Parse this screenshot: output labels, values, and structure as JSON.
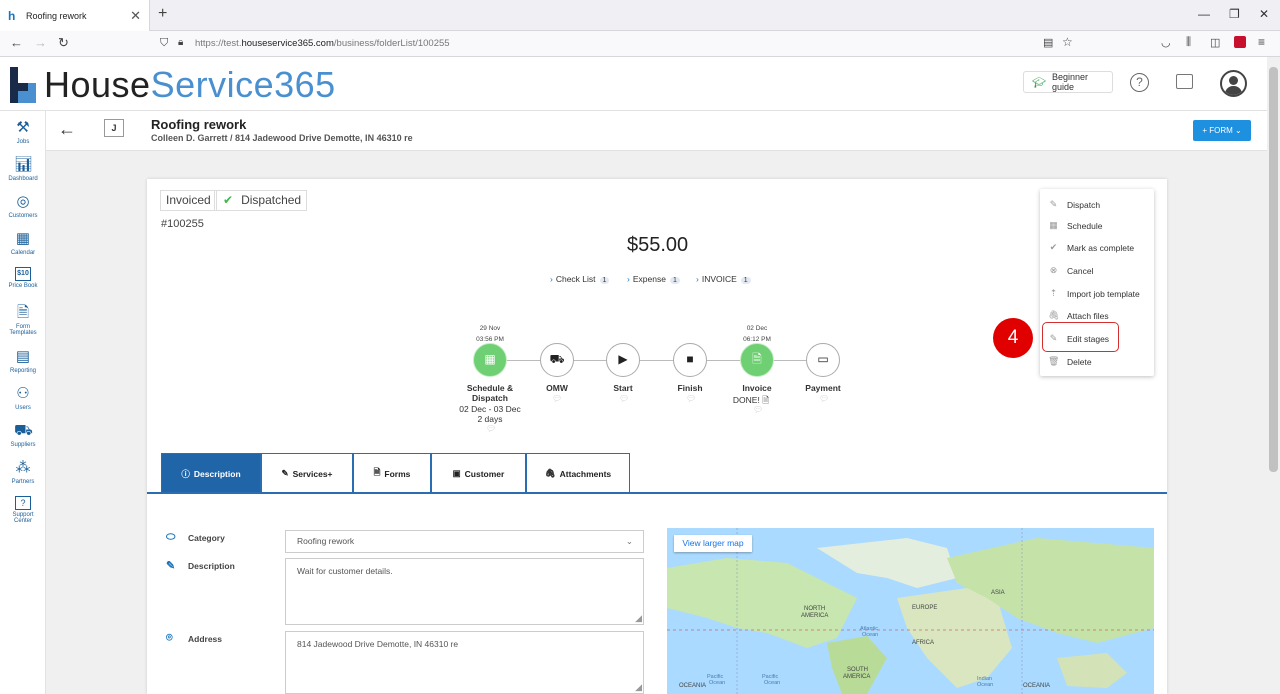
{
  "browser": {
    "tab_title": "Roofing rework",
    "url_prefix": "https://test.",
    "url_domain": "houseservice365.com",
    "url_path": "/business/folderList/100255"
  },
  "header": {
    "logo_part1": "House",
    "logo_part2": "Service365",
    "beginner_guide": "Beginner guide",
    "help_symbol": "?"
  },
  "sidebar": [
    {
      "label": "Jobs",
      "icon": "tools-icon"
    },
    {
      "label": "Dashboard",
      "icon": "dashboard-icon"
    },
    {
      "label": "Customers",
      "icon": "customers-icon"
    },
    {
      "label": "Calendar",
      "icon": "calendar-icon"
    },
    {
      "label": "Price Book",
      "icon": "price-book-icon",
      "glyph": "$10"
    },
    {
      "label": "Form",
      "label2": "Templates",
      "icon": "form-templates-icon"
    },
    {
      "label": "Reporting",
      "icon": "reporting-icon"
    },
    {
      "label": "Users",
      "icon": "users-icon"
    },
    {
      "label": "Suppliers",
      "icon": "truck-icon"
    },
    {
      "label": "Partners",
      "icon": "partners-icon"
    },
    {
      "label": "Support",
      "label2": "Center",
      "icon": "support-icon"
    }
  ],
  "job": {
    "badge": "J",
    "title": "Roofing rework",
    "subtitle": "Colleen D. Garrett / 814 Jadewood Drive Demotte, IN 46310 re",
    "form_button": "+ FORM ⌄",
    "status_invoiced": "Invoiced",
    "status_dispatched": "Dispatched",
    "number": "#100255",
    "price": "$55.00",
    "links": [
      {
        "label": "Check List",
        "count": "1"
      },
      {
        "label": "Expense",
        "count": "1"
      },
      {
        "label": "INVOICE",
        "count": "1"
      }
    ]
  },
  "stages": [
    {
      "label": "Schedule &",
      "label2": "Dispatch",
      "date": "29 Nov",
      "time": "03:56 PM",
      "extra1": "02 Dec - 03 Dec",
      "extra2": "2 days",
      "done": true
    },
    {
      "label": "OMW",
      "done": false
    },
    {
      "label": "Start",
      "done": false
    },
    {
      "label": "Finish",
      "done": false
    },
    {
      "label": "Invoice",
      "date": "02 Dec",
      "time": "06:12 PM",
      "extra1": "DONE!",
      "done": true
    },
    {
      "label": "Payment",
      "done": false
    }
  ],
  "menu": [
    {
      "label": "Dispatch",
      "icon": "pencil-icon"
    },
    {
      "label": "Schedule",
      "icon": "calendar-icon"
    },
    {
      "label": "Mark as complete",
      "icon": "check-icon"
    },
    {
      "label": "Cancel",
      "icon": "cancel-icon"
    },
    {
      "label": "Import job template",
      "icon": "upload-icon"
    },
    {
      "label": "Attach files",
      "icon": "paperclip-icon"
    },
    {
      "label": "Edit stages",
      "icon": "pencil-icon"
    },
    {
      "label": "Delete",
      "icon": "trash-icon"
    }
  ],
  "step_marker": "4",
  "tabs": [
    {
      "label": "Description",
      "active": true
    },
    {
      "label": "Services+"
    },
    {
      "label": "Forms"
    },
    {
      "label": "Customer"
    },
    {
      "label": "Attachments"
    }
  ],
  "form": {
    "category_label": "Category",
    "category_value": "Roofing rework",
    "description_label": "Description",
    "description_value": "Wait for customer details.",
    "address_label": "Address",
    "address_value": "814 Jadewood Drive Demotte, IN 46310 re"
  },
  "map": {
    "view_larger": "View larger map",
    "labels": [
      "NORTH",
      "AMERICA",
      "EUROPE",
      "ASIA",
      "AFRICA",
      "SOUTH",
      "AMERICA",
      "Atlantic",
      "Ocean",
      "Pacific",
      "Ocean",
      "Pacific",
      "Ocean",
      "Indian",
      "Ocean",
      "OCEANIA",
      "OCEANIA"
    ]
  }
}
